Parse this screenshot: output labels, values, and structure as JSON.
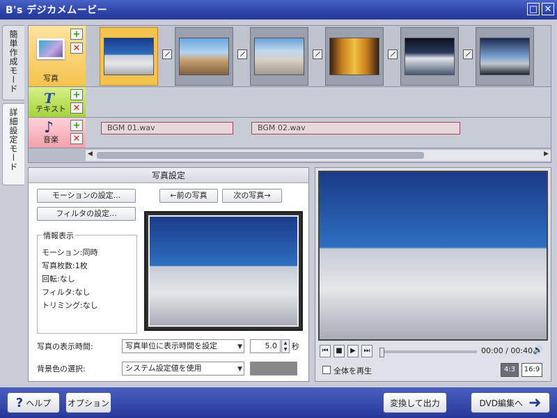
{
  "window": {
    "title": "B's デジカメムービー"
  },
  "modes": {
    "simple": "簡単作成モード",
    "detail": "詳細設定モード"
  },
  "tracks": {
    "photo_label": "写真",
    "text_label": "テキスト",
    "music_label": "音楽",
    "add_symbol": "+",
    "delete_symbol": "✕",
    "thumbnails": [
      "mountain-hiker",
      "group-on-summit",
      "mountain-shelter",
      "beer-mugs",
      "night-mountain",
      "dusk-silhouettes"
    ],
    "bgm": [
      "BGM 01.wav",
      "BGM 02.wav"
    ]
  },
  "settings": {
    "header": "写真設定",
    "motion_button": "モーションの設定...",
    "filter_button": "フィルタの設定...",
    "prev_photo": "←前の写真",
    "next_photo": "次の写真→",
    "info_title": "情報表示",
    "info": {
      "motion": "モーション:同時",
      "count": "写真枚数:1枚",
      "rotation": "回転:なし",
      "filter": "フィルタ:なし",
      "trimming": "トリミング:なし"
    },
    "display_time_label": "写真の表示時間:",
    "display_time_option": "写真単位に表示時間を設定",
    "display_time_value": "5.0",
    "display_time_unit": "秒",
    "bg_color_label": "背景色の選択:",
    "bg_color_option": "システム設定値を使用",
    "bg_color": "#888888"
  },
  "player": {
    "time": "00:00 / 00:40",
    "play_all": "全体を再生",
    "ratio_43": "4:3",
    "ratio_169": "16:9"
  },
  "footer": {
    "help": "ヘルプ",
    "options": "オプション",
    "convert": "変換して出力",
    "dvd": "DVD編集へ"
  }
}
